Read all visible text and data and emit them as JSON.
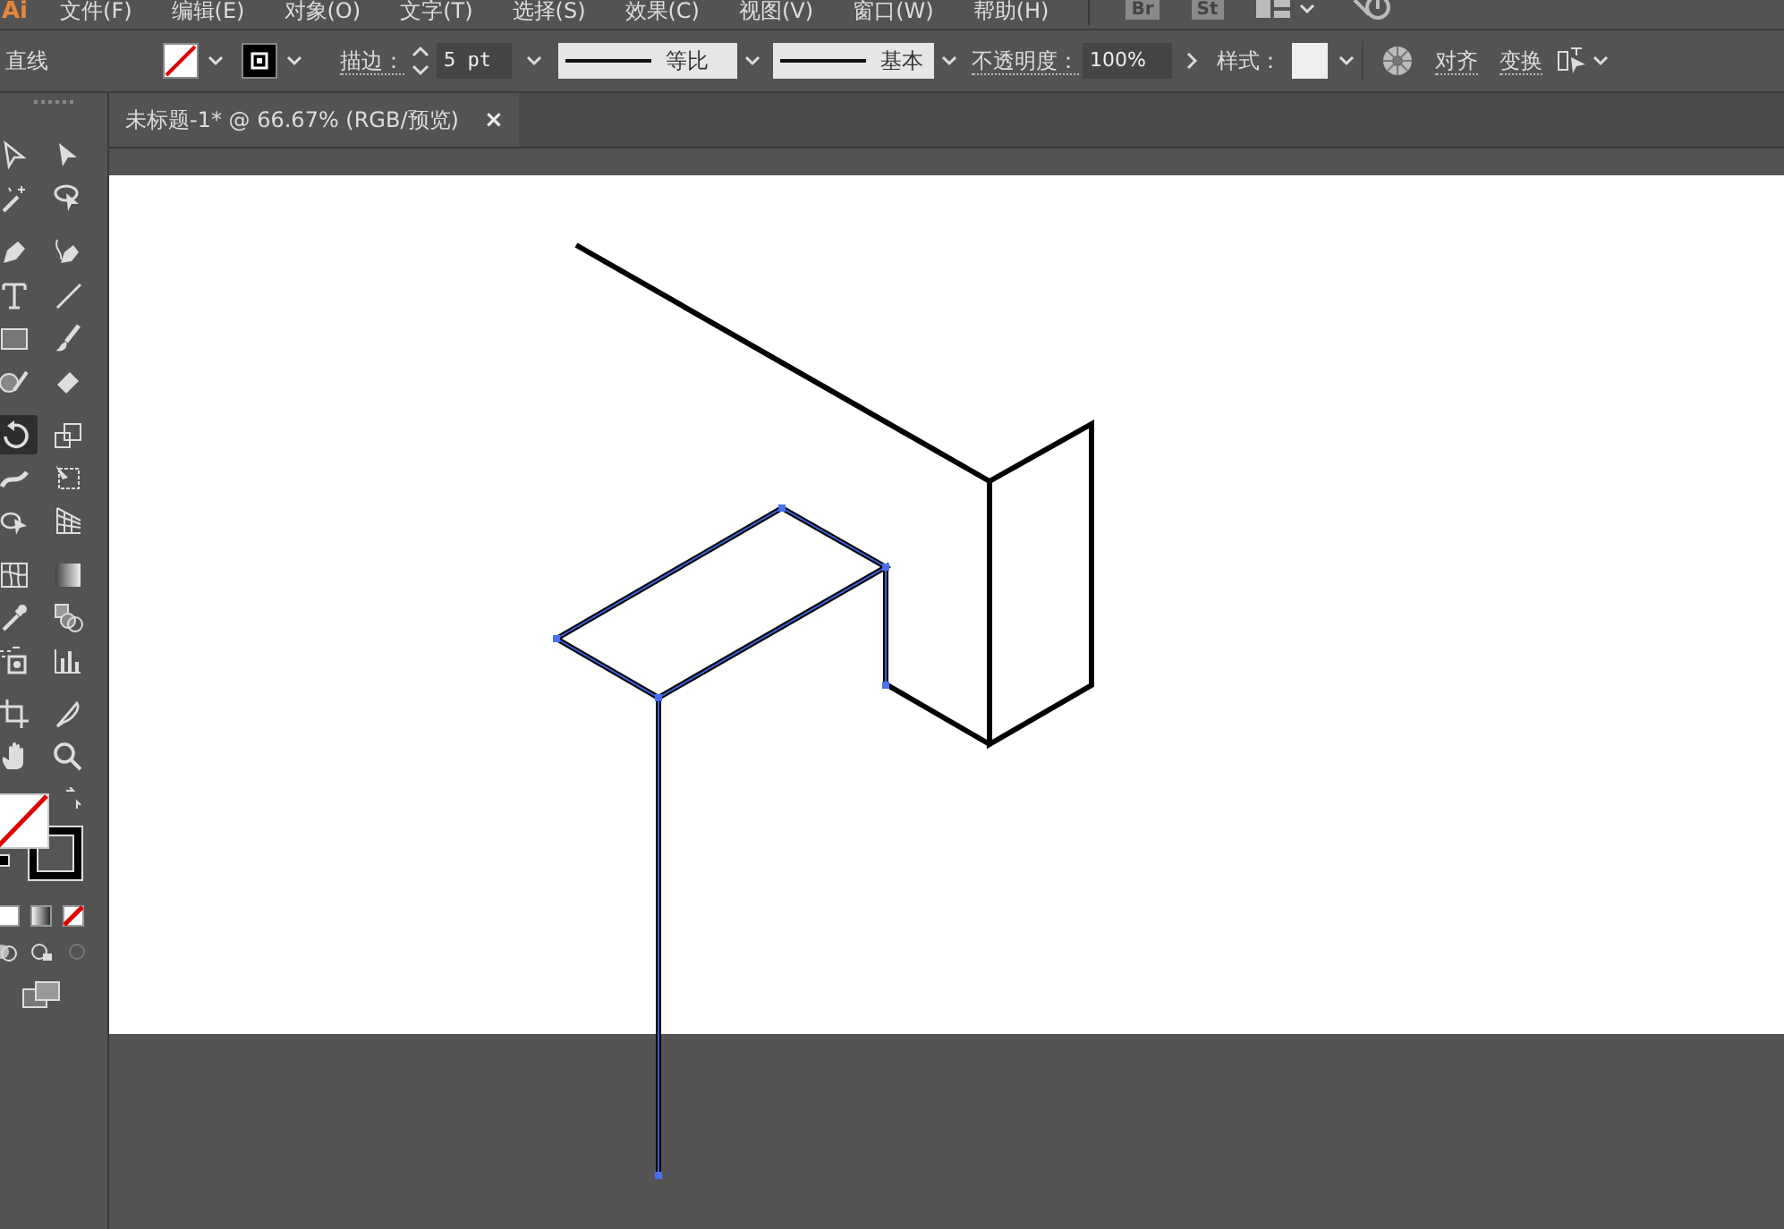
{
  "menu_bar": {
    "logo": "Ai",
    "items": [
      "文件(F)",
      "编辑(E)",
      "对象(O)",
      "文字(T)",
      "选择(S)",
      "效果(C)",
      "视图(V)",
      "窗口(W)",
      "帮助(H)"
    ],
    "app_buttons": [
      "Br",
      "St"
    ]
  },
  "control_bar": {
    "tool_name": "直线",
    "stroke_label": "描边：",
    "stroke_weight": "5 pt",
    "profile_1": "等比",
    "profile_2": "基本",
    "opacity_label": "不透明度：",
    "opacity": "100%",
    "style_label": "样式：",
    "align_button": "对齐",
    "transform_button": "变换"
  },
  "document_tab": {
    "title": "未标题-1* @ 66.67% (RGB/预览)",
    "close": "×"
  },
  "tools": [
    {
      "selected": false
    },
    {
      "selected": false
    },
    {
      "selected": false
    },
    {
      "selected": false
    },
    {
      "selected": false
    },
    {
      "selected": false
    },
    {
      "selected": false
    },
    {
      "selected": false
    },
    {
      "selected": false
    },
    {
      "selected": false
    },
    {
      "selected": false
    },
    {
      "selected": false
    },
    {
      "selected": true
    },
    {
      "selected": false
    },
    {
      "selected": false
    },
    {
      "selected": false
    },
    {
      "selected": false
    },
    {
      "selected": false
    },
    {
      "selected": false
    },
    {
      "selected": false
    },
    {
      "selected": false
    },
    {
      "selected": false
    },
    {
      "selected": false
    },
    {
      "selected": false
    },
    {
      "selected": false
    },
    {
      "selected": false
    },
    {
      "selected": false
    },
    {
      "selected": false
    }
  ],
  "artwork": {
    "paths": [
      {
        "selected": false
      },
      {
        "selected": false
      },
      {
        "selected": false
      },
      {
        "selected": true
      }
    ]
  }
}
